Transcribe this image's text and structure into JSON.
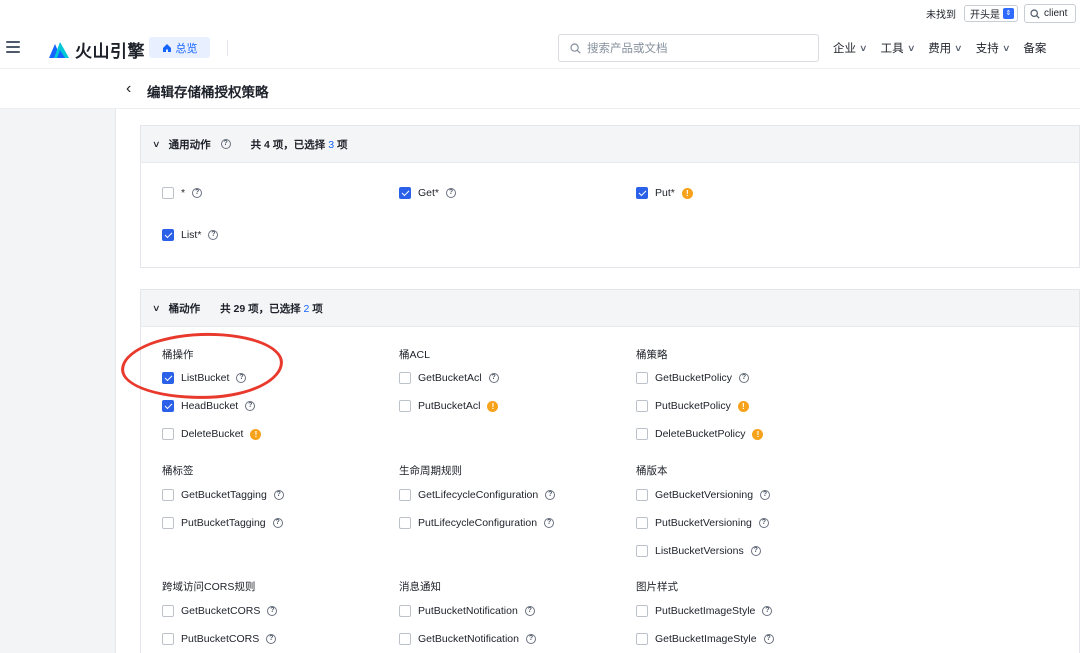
{
  "find_bar": {
    "label": "未找到",
    "mode": "开头是",
    "query": "client"
  },
  "nav": {
    "logo_text": "火山引擎",
    "overview_label": "总览",
    "search_placeholder": "搜索产品或文档",
    "menus": [
      "企业",
      "工具",
      "费用",
      "支持"
    ],
    "record_label": "备案"
  },
  "page": {
    "title": "编辑存储桶授权策略"
  },
  "general_panel": {
    "title": "通用动作",
    "count_prefix": "共 4 项，已选择 ",
    "count_selected": "3",
    "count_suffix": " 项",
    "items": [
      {
        "label": "*",
        "checked": false,
        "icon": "help"
      },
      {
        "label": "Get*",
        "checked": true,
        "icon": "help"
      },
      {
        "label": "Put*",
        "checked": true,
        "icon": "warning"
      },
      {
        "label": "List*",
        "checked": true,
        "icon": "help"
      }
    ]
  },
  "bucket_panel": {
    "title": "桶动作",
    "count_prefix": "共 29 项，已选择 ",
    "count_selected": "2",
    "count_suffix": " 项",
    "groups": [
      {
        "title": "桶操作",
        "items": [
          {
            "label": "ListBucket",
            "checked": true,
            "icon": "help"
          },
          {
            "label": "HeadBucket",
            "checked": true,
            "icon": "help"
          },
          {
            "label": "DeleteBucket",
            "checked": false,
            "icon": "warning"
          }
        ]
      },
      {
        "title": "桶ACL",
        "items": [
          {
            "label": "GetBucketAcl",
            "checked": false,
            "icon": "help"
          },
          {
            "label": "PutBucketAcl",
            "checked": false,
            "icon": "warning"
          }
        ]
      },
      {
        "title": "桶策略",
        "items": [
          {
            "label": "GetBucketPolicy",
            "checked": false,
            "icon": "help"
          },
          {
            "label": "PutBucketPolicy",
            "checked": false,
            "icon": "warning"
          },
          {
            "label": "DeleteBucketPolicy",
            "checked": false,
            "icon": "warning"
          }
        ]
      },
      {
        "title": "桶标签",
        "items": [
          {
            "label": "GetBucketTagging",
            "checked": false,
            "icon": "help"
          },
          {
            "label": "PutBucketTagging",
            "checked": false,
            "icon": "help"
          }
        ]
      },
      {
        "title": "生命周期规则",
        "items": [
          {
            "label": "GetLifecycleConfiguration",
            "checked": false,
            "icon": "help"
          },
          {
            "label": "PutLifecycleConfiguration",
            "checked": false,
            "icon": "help"
          }
        ]
      },
      {
        "title": "桶版本",
        "items": [
          {
            "label": "GetBucketVersioning",
            "checked": false,
            "icon": "help"
          },
          {
            "label": "PutBucketVersioning",
            "checked": false,
            "icon": "help"
          },
          {
            "label": "ListBucketVersions",
            "checked": false,
            "icon": "help"
          }
        ]
      },
      {
        "title": "跨域访问CORS规则",
        "items": [
          {
            "label": "GetBucketCORS",
            "checked": false,
            "icon": "help"
          },
          {
            "label": "PutBucketCORS",
            "checked": false,
            "icon": "help"
          }
        ]
      },
      {
        "title": "消息通知",
        "items": [
          {
            "label": "PutBucketNotification",
            "checked": false,
            "icon": "help"
          },
          {
            "label": "GetBucketNotification",
            "checked": false,
            "icon": "help"
          }
        ]
      },
      {
        "title": "图片样式",
        "items": [
          {
            "label": "PutBucketImageStyle",
            "checked": false,
            "icon": "help"
          },
          {
            "label": "GetBucketImageStyle",
            "checked": false,
            "icon": "help"
          }
        ]
      }
    ]
  },
  "colors": {
    "primary": "#1664ff",
    "checkbox_on": "#2b61e8",
    "warning": "#f7a21b",
    "annotation": "#e8392c"
  }
}
